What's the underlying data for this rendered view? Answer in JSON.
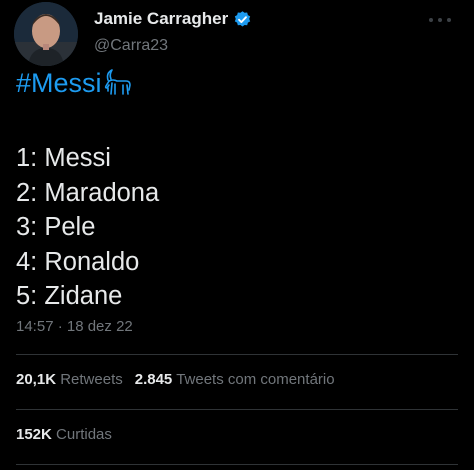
{
  "author": {
    "name": "Jamie Carragher",
    "handle": "@Carra23",
    "verified_icon": "verified-badge-icon",
    "avatar": "profile-photo"
  },
  "colors": {
    "background": "#000000",
    "primary_text": "#e7e9ea",
    "secondary_text": "#71767b",
    "accent": "#1d9bf0",
    "divider": "#2f3336"
  },
  "tweet": {
    "hashtag": "#Messi",
    "hashtag_emoji": "goat-emoji",
    "list": [
      "1: Messi",
      "2: Maradona",
      "3: Pele",
      "4: Ronaldo",
      "5: Zidane"
    ],
    "timestamp": "14:57 · 18 dez 22"
  },
  "stats": {
    "retweets_count": "20,1K",
    "retweets_label": "Retweets",
    "quotes_count": "2.845",
    "quotes_label": "Tweets com comentário",
    "likes_count": "152K",
    "likes_label": "Curtidas"
  }
}
